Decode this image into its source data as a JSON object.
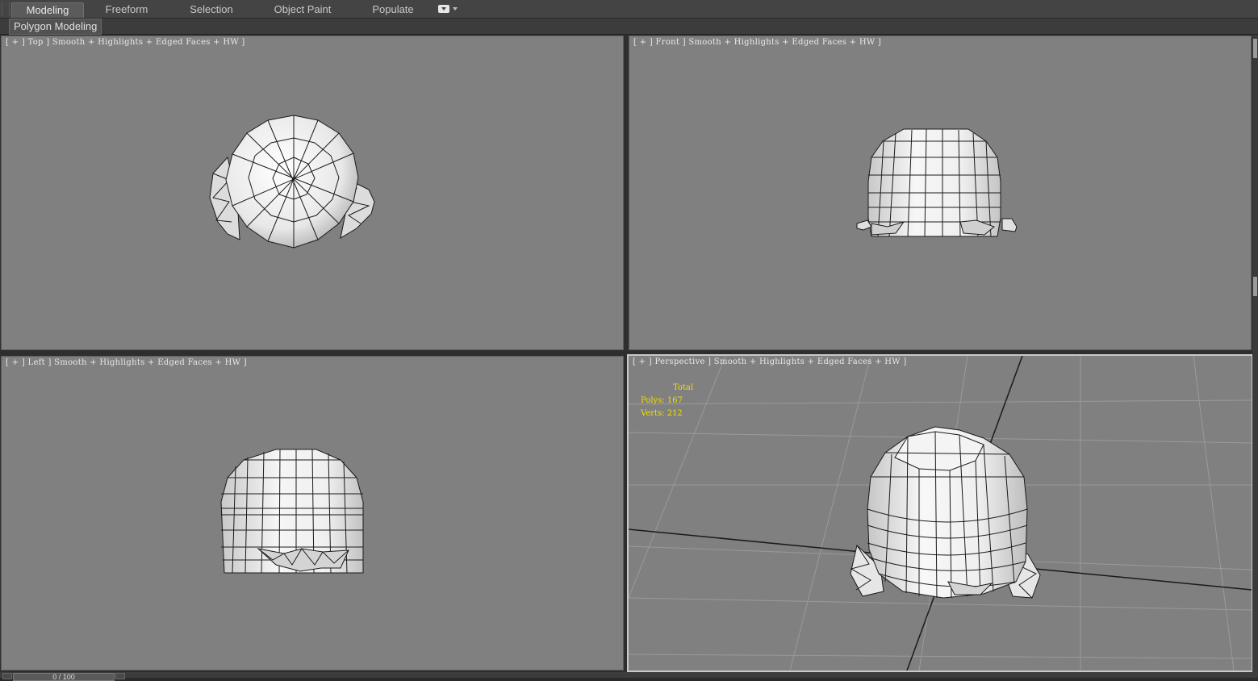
{
  "ribbon": {
    "tabs": [
      {
        "label": "Modeling",
        "active": true
      },
      {
        "label": "Freeform",
        "active": false
      },
      {
        "label": "Selection",
        "active": false
      },
      {
        "label": "Object Paint",
        "active": false
      },
      {
        "label": "Populate",
        "active": false
      }
    ],
    "options_icon": "dropdown-menu-icon",
    "panel": "Polygon Modeling"
  },
  "viewports": {
    "top": {
      "label": "[ + ] Top ] Smooth + Highlights + Edged Faces + HW ]"
    },
    "front": {
      "label": "[ + ] Front ] Smooth + Highlights + Edged Faces + HW ]"
    },
    "left": {
      "label": "[ + ] Left ] Smooth + Highlights + Edged Faces + HW ]"
    },
    "perspective": {
      "label": "[ + ] Perspective ] Smooth + Highlights + Edged Faces + HW ]",
      "active": true,
      "stats": {
        "header": "Total",
        "polys": "Polys: 167",
        "verts": "Verts: 212"
      }
    }
  },
  "timeline": {
    "frame": "0 / 100"
  },
  "colors": {
    "viewport_bg": "#808080",
    "mesh_fill": "#f2f2f2",
    "mesh_edge": "#1a1a1a",
    "stats_text": "#f0e000",
    "active_border": "#c9c9c9"
  }
}
